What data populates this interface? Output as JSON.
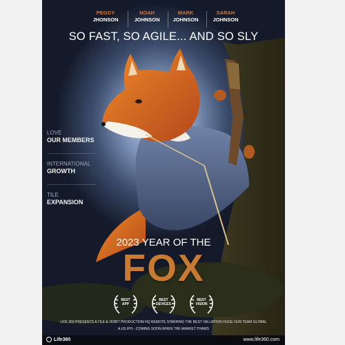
{
  "cast": [
    {
      "first": "PEGGY",
      "last": "JHONSON"
    },
    {
      "first": "NOAH",
      "last": "JOHNSON"
    },
    {
      "first": "MARK",
      "last": "JOHNSON"
    },
    {
      "first": "SARAH",
      "last": "JOHNSON"
    }
  ],
  "tagline": "SO FAST, SO AGILE... AND SO SLY",
  "side": [
    {
      "top": "LOVE",
      "bottom": "OUR MEMBERS"
    },
    {
      "top": "INTERNATIONAL",
      "bottom": "GROWTH"
    },
    {
      "top": "TILE",
      "bottom": "EXPANSION"
    }
  ],
  "headline": {
    "year": "2023 YEAR OF THE",
    "word": "FOX"
  },
  "awards": [
    {
      "line1": "BEST",
      "line2": "APP"
    },
    {
      "line1": "BEST",
      "line2": "DEVICES"
    },
    {
      "line1": "BEST",
      "line2": "VISION"
    }
  ],
  "credits": {
    "line1": "LIFE 360 PRESENTS A TILE  & JIOBIT PRODUCTION HQ REMOTE STARRING THE BEST VALUATION HUGE OUR TEAM GLOBAL",
    "line2": "A US IPO - COMING SOON WHEN THE MARKET THAWS"
  },
  "footer": {
    "logo": "Life360",
    "url": "www.life360.com"
  },
  "colors": {
    "accent": "#c87a32",
    "background": "#0f131d",
    "page": "#f2f2f2"
  }
}
